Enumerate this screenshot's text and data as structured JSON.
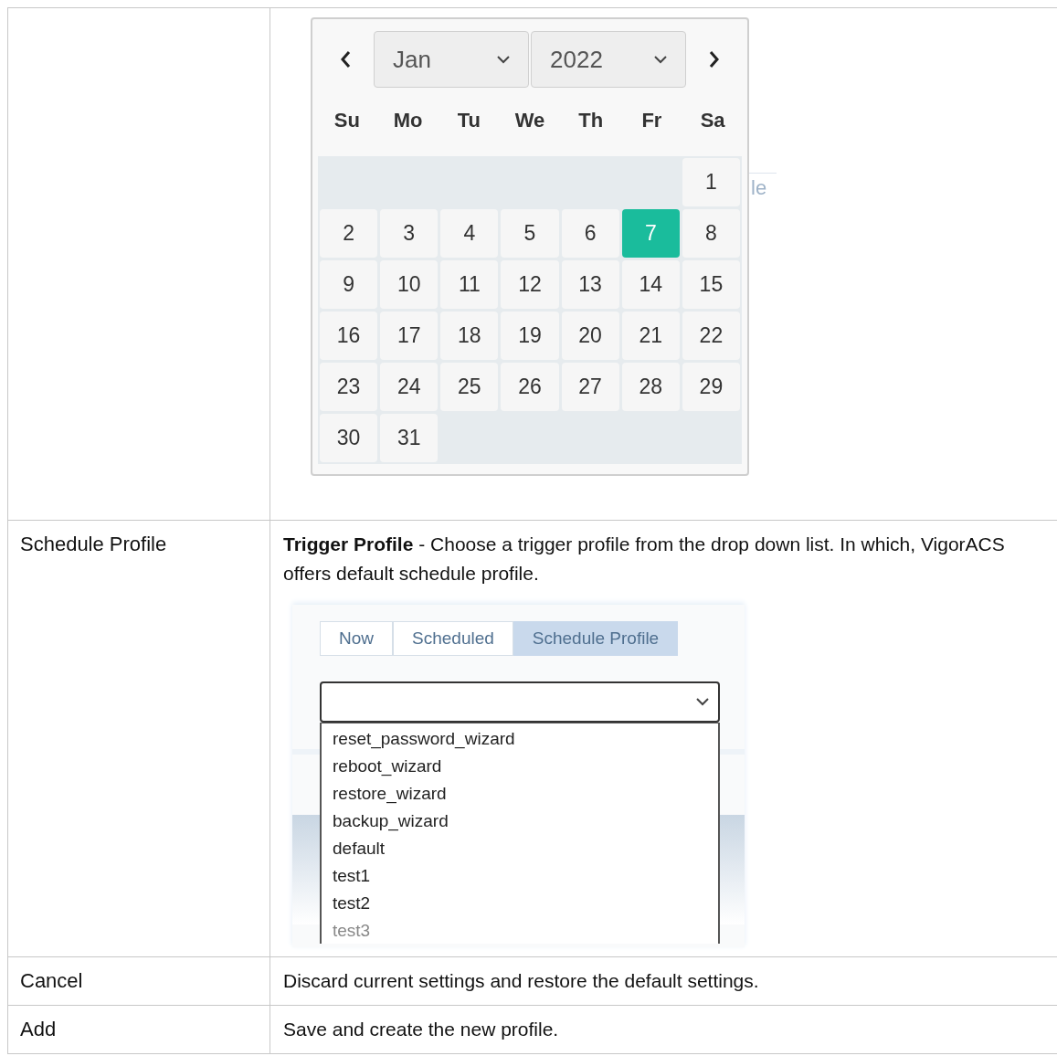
{
  "rows": [
    {
      "kind": "calendar",
      "calendar": {
        "month": "Jan",
        "year": "2022",
        "weekdays": [
          "Su",
          "Mo",
          "Tu",
          "We",
          "Th",
          "Fr",
          "Sa"
        ],
        "weeks": [
          [
            {
              "kind": "blank"
            },
            {
              "kind": "blank"
            },
            {
              "kind": "blank"
            },
            {
              "kind": "blank"
            },
            {
              "kind": "blank"
            },
            {
              "kind": "blank"
            },
            {
              "kind": "day",
              "day": "1",
              "selected": false
            }
          ],
          [
            {
              "kind": "day",
              "day": "2",
              "selected": false
            },
            {
              "kind": "day",
              "day": "3",
              "selected": false
            },
            {
              "kind": "day",
              "day": "4",
              "selected": false
            },
            {
              "kind": "day",
              "day": "5",
              "selected": false
            },
            {
              "kind": "day",
              "day": "6",
              "selected": false
            },
            {
              "kind": "day",
              "day": "7",
              "selected": true
            },
            {
              "kind": "day",
              "day": "8",
              "selected": false
            }
          ],
          [
            {
              "kind": "day",
              "day": "9",
              "selected": false
            },
            {
              "kind": "day",
              "day": "10",
              "selected": false
            },
            {
              "kind": "day",
              "day": "11",
              "selected": false
            },
            {
              "kind": "day",
              "day": "12",
              "selected": false
            },
            {
              "kind": "day",
              "day": "13",
              "selected": false
            },
            {
              "kind": "day",
              "day": "14",
              "selected": false
            },
            {
              "kind": "day",
              "day": "15",
              "selected": false
            }
          ],
          [
            {
              "kind": "day",
              "day": "16",
              "selected": false
            },
            {
              "kind": "day",
              "day": "17",
              "selected": false
            },
            {
              "kind": "day",
              "day": "18",
              "selected": false
            },
            {
              "kind": "day",
              "day": "19",
              "selected": false
            },
            {
              "kind": "day",
              "day": "20",
              "selected": false
            },
            {
              "kind": "day",
              "day": "21",
              "selected": false
            },
            {
              "kind": "day",
              "day": "22",
              "selected": false
            }
          ],
          [
            {
              "kind": "day",
              "day": "23",
              "selected": false
            },
            {
              "kind": "day",
              "day": "24",
              "selected": false
            },
            {
              "kind": "day",
              "day": "25",
              "selected": false
            },
            {
              "kind": "day",
              "day": "26",
              "selected": false
            },
            {
              "kind": "day",
              "day": "27",
              "selected": false
            },
            {
              "kind": "day",
              "day": "28",
              "selected": false
            },
            {
              "kind": "day",
              "day": "29",
              "selected": false
            }
          ],
          [
            {
              "kind": "day",
              "day": "30",
              "selected": false
            },
            {
              "kind": "day",
              "day": "31",
              "selected": false
            },
            {
              "kind": "blank"
            },
            {
              "kind": "blank"
            },
            {
              "kind": "blank"
            },
            {
              "kind": "blank"
            },
            {
              "kind": "blank"
            }
          ]
        ],
        "behind_text": "le"
      }
    },
    {
      "label": "Schedule Profile",
      "kind": "profile",
      "description": "**Trigger Profile** - Choose a trigger profile from the drop down list. In which, VigorACS offers default schedule profile.",
      "tabs": [
        {
          "label": "Now",
          "selected": false
        },
        {
          "label": "Scheduled",
          "selected": false
        },
        {
          "label": "Schedule Profile",
          "selected": true
        }
      ],
      "options": [
        "reset_password_wizard",
        "reboot_wizard",
        "restore_wizard",
        "backup_wizard",
        "default",
        "test1",
        "test2",
        "test3"
      ]
    },
    {
      "label": "Cancel",
      "kind": "text",
      "description": "Discard current settings and restore the default settings."
    },
    {
      "label": "Add",
      "kind": "text",
      "description": "Save and create the new profile."
    }
  ]
}
